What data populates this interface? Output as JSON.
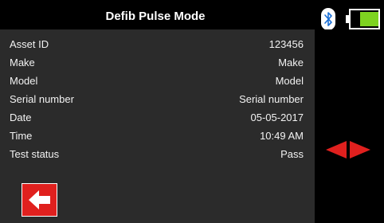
{
  "header": {
    "title": "Defib Pulse Mode",
    "bluetooth_icon": "bluetooth-icon",
    "battery_icon": "battery-icon",
    "battery_level": 0.65,
    "battery_color": "#7ed321"
  },
  "fields": [
    {
      "label": "Asset ID",
      "value": "123456"
    },
    {
      "label": "Make",
      "value": "Make"
    },
    {
      "label": "Model",
      "value": "Model"
    },
    {
      "label": "Serial number",
      "value": "Serial number"
    },
    {
      "label": "Date",
      "value": "05-05-2017"
    },
    {
      "label": "Time",
      "value": "10:49 AM"
    },
    {
      "label": "Test status",
      "value": "Pass"
    }
  ],
  "controls": {
    "nav_arrows_icon": "left-right-arrows-icon",
    "back_icon": "back-arrow-icon",
    "accent_color": "#e0201e"
  }
}
